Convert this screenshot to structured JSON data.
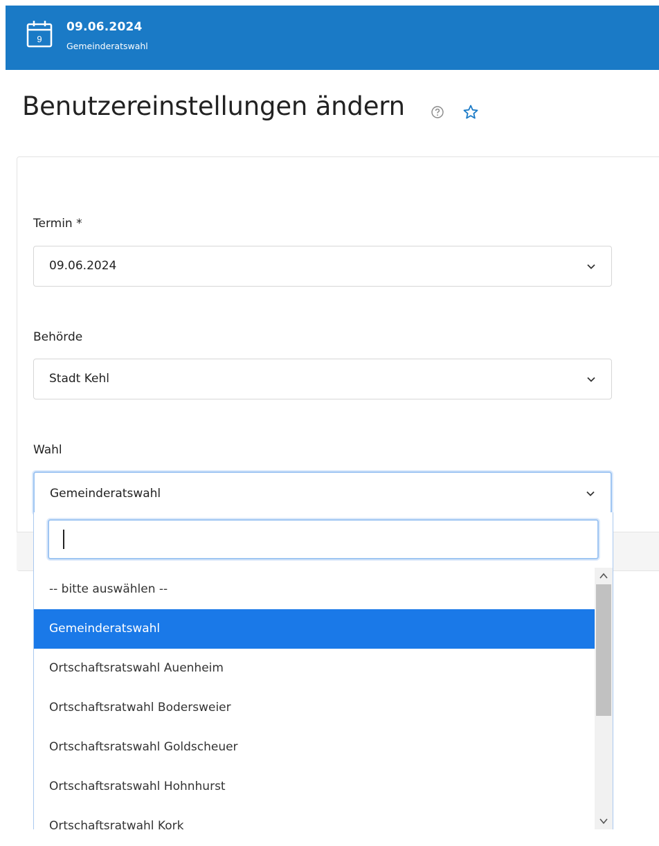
{
  "header": {
    "date": "09.06.2024",
    "calendar_day": "9",
    "subtitle": "Gemeinderatswahl"
  },
  "page": {
    "title": "Benutzereinstellungen ändern"
  },
  "form": {
    "termin": {
      "label": "Termin *",
      "value": "09.06.2024"
    },
    "behoerde": {
      "label": "Behörde",
      "value": "Stadt Kehl"
    },
    "wahl": {
      "label": "Wahl",
      "value": "Gemeinderatswahl"
    }
  },
  "dropdown": {
    "search_value": "",
    "options": [
      "-- bitte auswählen --",
      "Gemeinderatswahl",
      "Ortschaftsratswahl Auenheim",
      "Ortschaftsratwahl Bodersweier",
      "Ortschaftsratswahl Goldscheuer",
      "Ortschaftsratswahl Hohnhurst",
      "Ortschaftsratwahl Kork"
    ],
    "selected_index": 1
  },
  "colors": {
    "header_bg": "#1a7ac6",
    "selected_option_bg": "#1a79e8",
    "focus_border": "#9ec5f2",
    "star": "#1a7ac6"
  },
  "icons": {
    "header": "calendar-icon",
    "help": "help-circle-icon",
    "favorite": "star-icon",
    "select": "chevron-down-icon"
  }
}
